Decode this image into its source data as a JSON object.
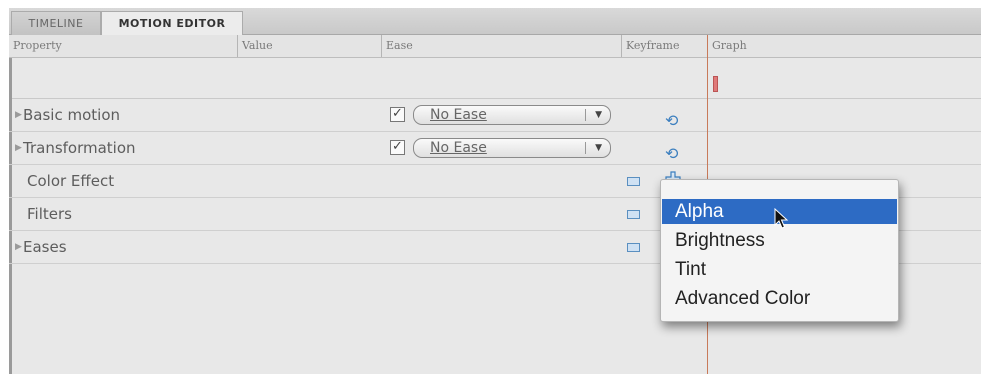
{
  "tabs": [
    {
      "label": "TIMELINE"
    },
    {
      "label": "MOTION EDITOR"
    }
  ],
  "columns": [
    "Property",
    "Value",
    "Ease",
    "Keyframe",
    "Graph"
  ],
  "rows": [
    {
      "label": "Basic motion",
      "has_expander": true,
      "ease_checked": true,
      "ease": "No Ease"
    },
    {
      "label": "Transformation",
      "has_expander": true,
      "ease_checked": true,
      "ease": "No Ease"
    },
    {
      "label": "Color Effect",
      "has_expander": false
    },
    {
      "label": "Filters",
      "has_expander": false
    },
    {
      "label": "Eases",
      "has_expander": true
    }
  ],
  "context_menu": {
    "items": [
      "Alpha",
      "Brightness",
      "Tint",
      "Advanced Color"
    ],
    "selected": "Alpha"
  },
  "colors": {
    "accent": "#2d6bc4",
    "keyframe_icon": "#3c7fbf",
    "playhead": "#e07a7a"
  }
}
